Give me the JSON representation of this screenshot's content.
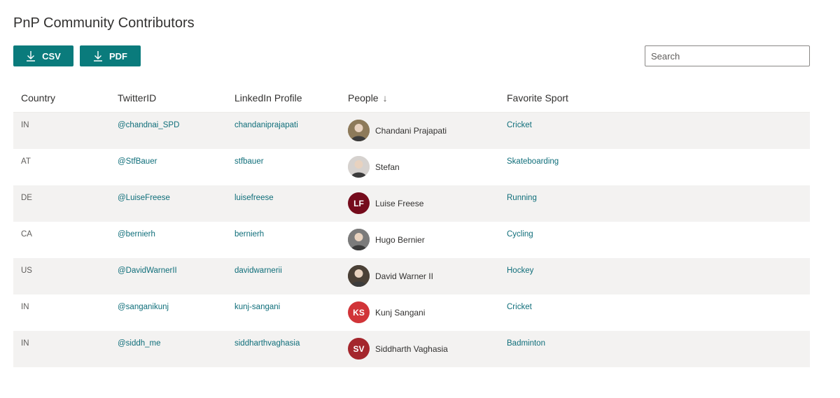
{
  "page": {
    "title": "PnP Community Contributors"
  },
  "toolbar": {
    "csv_label": "CSV",
    "pdf_label": "PDF",
    "search_placeholder": "Search",
    "accent": "#0a7b7c"
  },
  "table": {
    "headers": {
      "country": "Country",
      "twitter": "TwitterID",
      "linkedin": "LinkedIn Profile",
      "people": "People",
      "sport": "Favorite Sport"
    },
    "sort_indicator": "↓",
    "rows": [
      {
        "country": "IN",
        "twitter": "@chandnai_SPD",
        "linkedin": "chandaniprajapati",
        "person": "Chandani Prajapati",
        "avatar": {
          "type": "photo",
          "color": "#8d7a5a"
        },
        "sport": "Cricket"
      },
      {
        "country": "AT",
        "twitter": "@StfBauer",
        "linkedin": "stfbauer",
        "person": "Stefan",
        "avatar": {
          "type": "photo",
          "color": "#d6d2cf"
        },
        "sport": "Skateboarding"
      },
      {
        "country": "DE",
        "twitter": "@LuiseFreese",
        "linkedin": "luisefreese",
        "person": "Luise Freese",
        "avatar": {
          "type": "initials",
          "initials": "LF",
          "color": "#750b1c"
        },
        "sport": "Running"
      },
      {
        "country": "CA",
        "twitter": "@bernierh",
        "linkedin": "bernierh",
        "person": "Hugo Bernier",
        "avatar": {
          "type": "photo",
          "color": "#7b7b7b"
        },
        "sport": "Cycling"
      },
      {
        "country": "US",
        "twitter": "@DavidWarnerII",
        "linkedin": "davidwarnerii",
        "person": "David Warner II",
        "avatar": {
          "type": "photo",
          "color": "#4a4036"
        },
        "sport": "Hockey"
      },
      {
        "country": "IN",
        "twitter": "@sanganikunj",
        "linkedin": "kunj-sangani",
        "person": "Kunj Sangani",
        "avatar": {
          "type": "initials",
          "initials": "KS",
          "color": "#d13438"
        },
        "sport": "Cricket"
      },
      {
        "country": "IN",
        "twitter": "@siddh_me",
        "linkedin": "siddharthvaghasia",
        "person": "Siddharth Vaghasia",
        "avatar": {
          "type": "initials",
          "initials": "SV",
          "color": "#a4262c"
        },
        "sport": "Badminton"
      }
    ]
  }
}
